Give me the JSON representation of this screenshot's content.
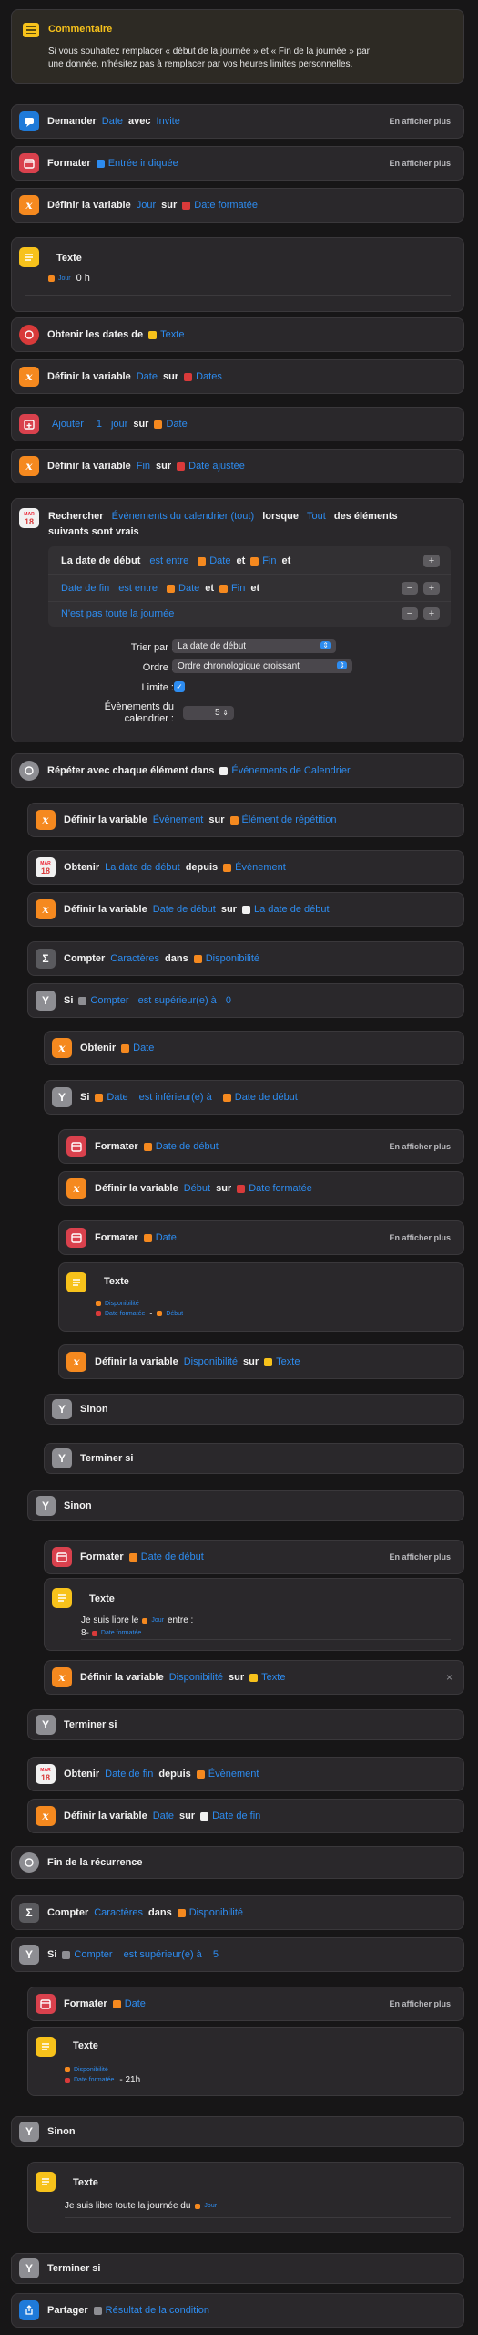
{
  "comment": {
    "title": "Commentaire",
    "body_line1": "Si vous souhaitez remplacer « début de la journée » et « Fin de la journée » par",
    "body_line2": "une donnée, n'hésitez pas à remplacer par vos heures limites personnelles."
  },
  "common": {
    "show_more": "En afficher plus",
    "dans": "dans",
    "sur": "sur",
    "depuis": "depuis",
    "et": "et",
    "avec": "avec"
  },
  "a1": {
    "label": "Demander",
    "t1": "Date",
    "t2": "Invite"
  },
  "a2": {
    "label": "Formater",
    "t1": "Entrée indiquée"
  },
  "a3": {
    "label": "Définir la variable",
    "t1": "Jour",
    "t2": "Date formatée"
  },
  "a4": {
    "label": "Texte",
    "var": "Jour",
    "text": "0 h"
  },
  "a5": {
    "label": "Obtenir les dates de",
    "t1": "Texte"
  },
  "a6": {
    "label": "Définir la variable",
    "t1": "Date",
    "t2": "Dates"
  },
  "a7": {
    "label": "Ajouter",
    "n": "1",
    "unit": "jour",
    "t2": "Date"
  },
  "a8": {
    "label": "Définir la variable",
    "t1": "Fin",
    "t2": "Date ajustée"
  },
  "a9": {
    "label": "Rechercher",
    "t1": "Événements du calendrier (tout)",
    "w1": "lorsque",
    "t2": "Tout",
    "w2": "des éléments",
    "w3": "suivants sont vrais",
    "f1_label": "La date de début",
    "f1_op": "est entre",
    "f1_a": "Date",
    "f1_b": "Fin",
    "f2_label": "Date de fin",
    "f2_op": "est entre",
    "f2_a": "Date",
    "f2_b": "Fin",
    "f3_label": "N'est pas toute la journée",
    "sort_label": "Trier par :",
    "sort_value": "La date de début",
    "order_label": "Ordre :",
    "order_value": "Ordre chronologique croissant",
    "limit_label": "Limite :",
    "limit_check": "✓",
    "count_label1": "Évènements du",
    "count_label2": "calendrier :",
    "count_value": "5"
  },
  "a10": {
    "label": "Répéter avec chaque élément dans",
    "t1": "Événements de Calendrier"
  },
  "a11": {
    "label": "Définir la variable",
    "t1": "Évènement",
    "t2": "Élément de répétition"
  },
  "a12": {
    "label": "Obtenir",
    "t1": "La date de début",
    "t2": "Évènement"
  },
  "a13": {
    "label": "Définir la variable",
    "t1": "Date de début",
    "t2": "La date de début"
  },
  "a14": {
    "label": "Compter",
    "t1": "Caractères",
    "t2": "Disponibilité"
  },
  "a15": {
    "label": "Si",
    "t1": "Compter",
    "op": "est supérieur(e) à",
    "v": "0"
  },
  "a16": {
    "label": "Obtenir",
    "t1": "Date"
  },
  "a17": {
    "label": "Si",
    "t1": "Date",
    "op": "est inférieur(e) à",
    "t2": "Date de début"
  },
  "a18": {
    "label": "Formater",
    "t1": "Date de début"
  },
  "a19": {
    "label": "Définir la variable",
    "t1": "Début",
    "t2": "Date formatée"
  },
  "a20": {
    "label": "Formater",
    "t1": "Date"
  },
  "a21": {
    "label": "Texte",
    "v1": "Disponibilité",
    "v2": "Date formatée",
    "sep": "-",
    "v3": "Début"
  },
  "a22": {
    "label": "Définir la variable",
    "t1": "Disponibilité",
    "t2": "Texte"
  },
  "a23": {
    "label": "Sinon"
  },
  "a24": {
    "label": "Terminer si"
  },
  "a25": {
    "label": "Sinon"
  },
  "a26": {
    "label": "Formater",
    "t1": "Date de début"
  },
  "a27": {
    "label": "Texte",
    "l1a": "Je suis libre le",
    "l1var": "Jour",
    "l1b": "entre :",
    "l2a": "8-",
    "l2var": "Date formatée"
  },
  "a28": {
    "label": "Définir la variable",
    "t1": "Disponibilité",
    "t2": "Texte",
    "close": "×"
  },
  "a29": {
    "label": "Terminer si"
  },
  "a30": {
    "label": "Obtenir",
    "t1": "Date de fin",
    "t2": "Évènement"
  },
  "a31": {
    "label": "Définir la variable",
    "t1": "Date",
    "t2": "Date de fin"
  },
  "a32": {
    "label": "Fin de la récurrence"
  },
  "a33": {
    "label": "Compter",
    "t1": "Caractères",
    "t2": "Disponibilité"
  },
  "a34": {
    "label": "Si",
    "t1": "Compter",
    "op": "est supérieur(e) à",
    "v": "5"
  },
  "a35": {
    "label": "Formater",
    "t1": "Date"
  },
  "a36": {
    "label": "Texte",
    "v1": "Disponibilité",
    "v2": "Date formatée",
    "tail": "- 21h"
  },
  "a37": {
    "label": "Sinon"
  },
  "a38": {
    "label": "Texte",
    "text": "Je suis libre toute la journée du",
    "var": "Jour"
  },
  "a39": {
    "label": "Terminer si"
  },
  "a40": {
    "label": "Partager",
    "t1": "Résultat de la condition"
  }
}
